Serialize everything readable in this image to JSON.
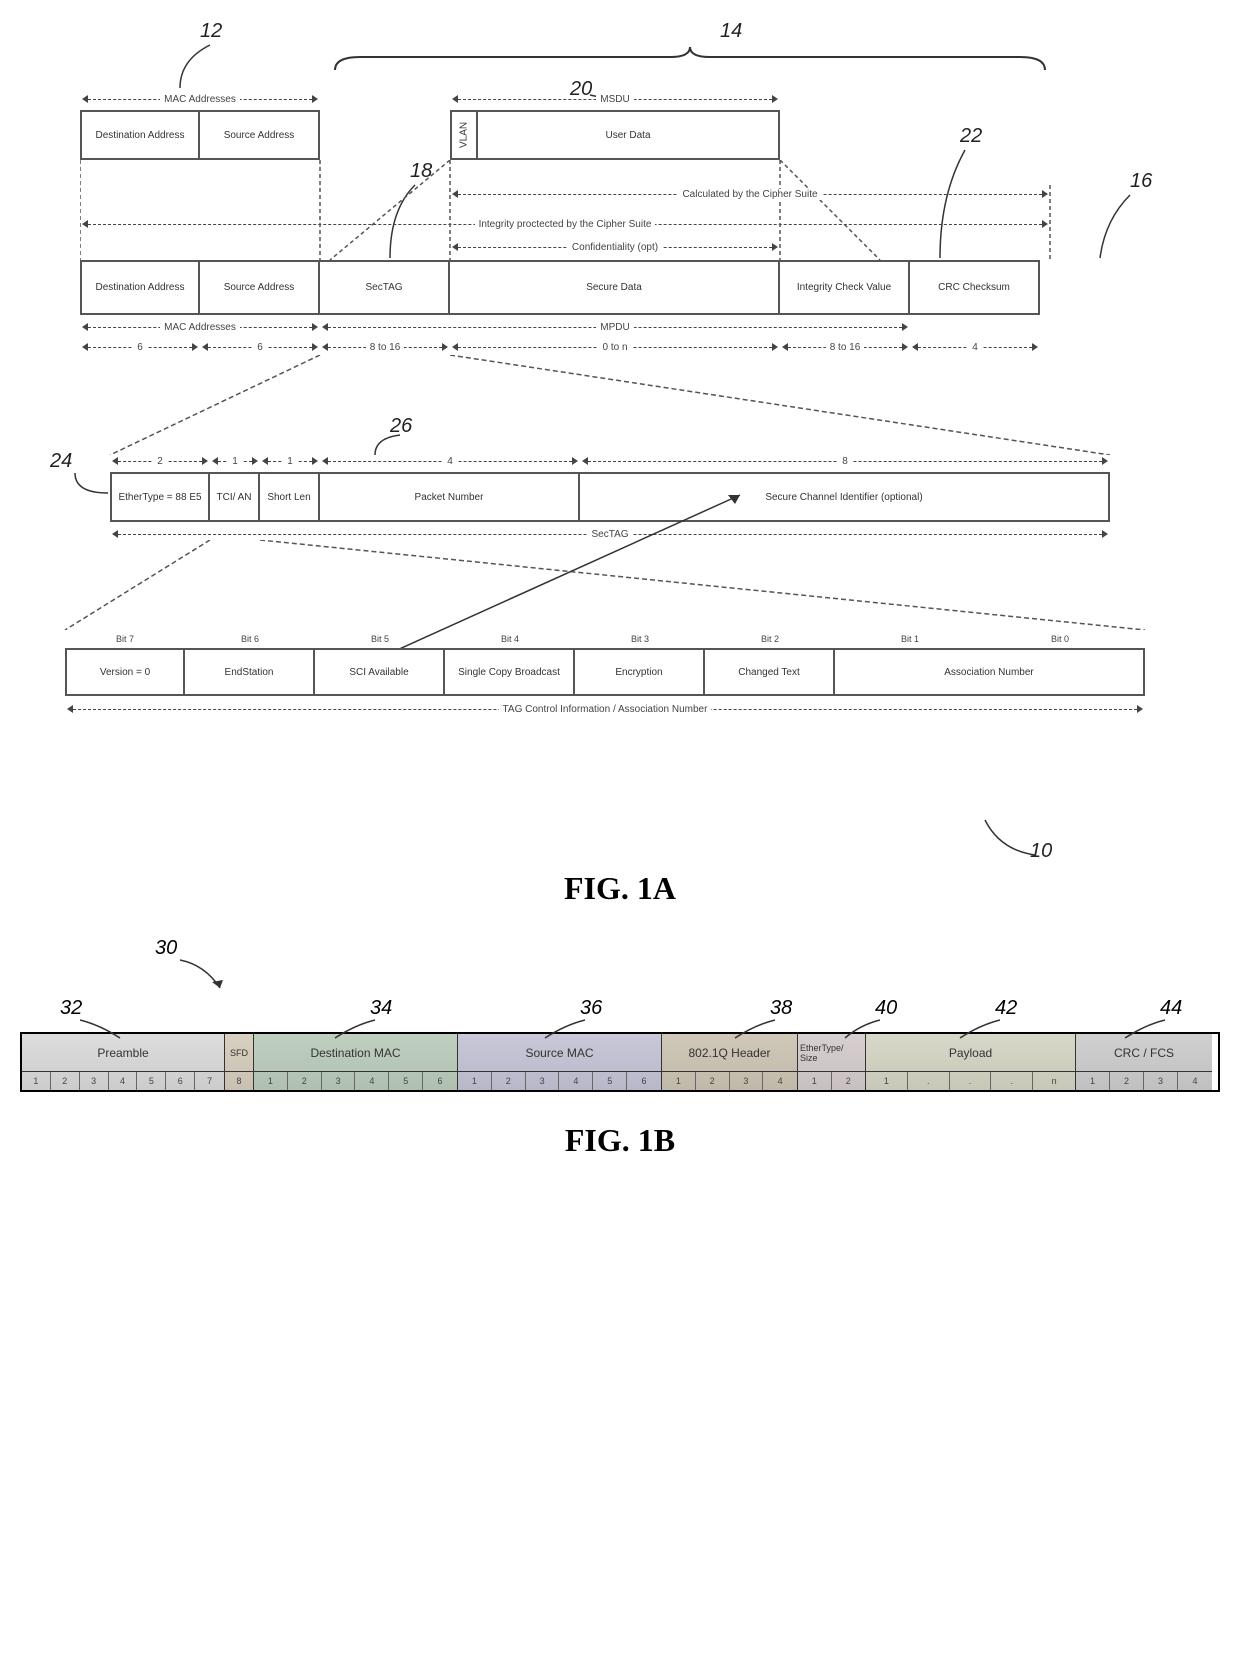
{
  "figA": {
    "callouts": {
      "c12": "12",
      "c14": "14",
      "c16": "16",
      "c18": "18",
      "c20": "20",
      "c22": "22",
      "c24": "24",
      "c26": "26",
      "c10": "10"
    },
    "top_labels": {
      "mac_addresses": "MAC Addresses",
      "msdu": "MSDU"
    },
    "user_row": {
      "dest": "Destination Address",
      "src": "Source Address",
      "vlan": "VLAN",
      "userdata": "User Data"
    },
    "mid_labels": {
      "integrity": "Integrity proctected by the Cipher Suite",
      "calc": "Calculated by the Cipher Suite",
      "conf": "Confidentiality (opt)"
    },
    "main_row": {
      "dest": "Destination Address",
      "src": "Source Address",
      "sectag": "SecTAG",
      "secure": "Secure Data",
      "icv": "Integrity Check Value",
      "crc": "CRC Checksum"
    },
    "below_labels": {
      "mac": "MAC Addresses",
      "mpdu": "MPDU"
    },
    "sizes": {
      "six_a": "6",
      "six_b": "6",
      "eight16_a": "8 to 16",
      "zeron": "0 to n",
      "eight16_b": "8 to 16",
      "four": "4"
    },
    "sectag_sizes": {
      "two": "2",
      "one_a": "1",
      "one_b": "1",
      "four": "4",
      "eight": "8"
    },
    "sectag_row": {
      "ethertype": "EtherType = 88 E5",
      "tci": "TCI/ AN",
      "shortlen": "Short Len",
      "pn": "Packet Number",
      "sci": "Secure Channel Identifier (optional)"
    },
    "sectag_label": "SecTAG",
    "bits": {
      "b7": "Bit 7",
      "b6": "Bit 6",
      "b5": "Bit 5",
      "b4": "Bit 4",
      "b3": "Bit 3",
      "b2": "Bit 2",
      "b1": "Bit 1",
      "b0": "Bit 0"
    },
    "tci_row": {
      "version": "Version = 0",
      "endstation": "EndStation",
      "sci_avail": "SCI Available",
      "scb": "Single Copy Broadcast",
      "encryption": "Encryption",
      "changed": "Changed Text",
      "an": "Association Number"
    },
    "tci_label": "TAG Control Information / Association Number",
    "title": "FIG. 1A"
  },
  "figB": {
    "callouts": {
      "c30": "30",
      "c32": "32",
      "c34": "34",
      "c36": "36",
      "c38": "38",
      "c40": "40",
      "c42": "42",
      "c44": "44"
    },
    "cols": {
      "preamble": "Preamble",
      "sfd": "SFD",
      "dest": "Destination MAC",
      "src": "Source MAC",
      "q": "802.1Q Header",
      "etype": "EtherType/ Size",
      "payload": "Payload",
      "crc": "CRC / FCS"
    },
    "bytes": {
      "preamble": [
        "1",
        "2",
        "3",
        "4",
        "5",
        "6",
        "7"
      ],
      "sfd": [
        "8"
      ],
      "dest": [
        "1",
        "2",
        "3",
        "4",
        "5",
        "6"
      ],
      "src": [
        "1",
        "2",
        "3",
        "4",
        "5",
        "6"
      ],
      "q": [
        "1",
        "2",
        "3",
        "4"
      ],
      "etype": [
        "1",
        "2"
      ],
      "payload": [
        "1",
        ".",
        ".",
        ".",
        "n"
      ],
      "crc": [
        "1",
        "2",
        "3",
        "4"
      ]
    },
    "title": "FIG. 1B"
  }
}
